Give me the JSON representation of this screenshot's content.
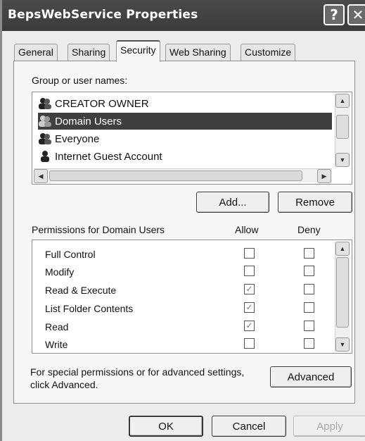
{
  "window": {
    "title": "BepsWebService Properties",
    "help_glyph": "?",
    "close_glyph": "✕"
  },
  "tabs": [
    {
      "label": "General",
      "active": false
    },
    {
      "label": "Sharing",
      "active": false
    },
    {
      "label": "Security",
      "active": true
    },
    {
      "label": "Web Sharing",
      "active": false
    },
    {
      "label": "Customize",
      "active": false
    }
  ],
  "group_section": {
    "label": "Group or user names:",
    "users": [
      {
        "name": "CREATOR OWNER",
        "icon": "group-icon",
        "selected": false
      },
      {
        "name": "Domain Users",
        "icon": "group-icon",
        "selected": true
      },
      {
        "name": "Everyone",
        "icon": "group-icon",
        "selected": false
      },
      {
        "name": "Internet Guest Account",
        "icon": "user-icon",
        "selected": false
      }
    ]
  },
  "buttons": {
    "add": "Add...",
    "remove": "Remove",
    "advanced": "Advanced",
    "ok": "OK",
    "cancel": "Cancel",
    "apply": "Apply"
  },
  "permissions": {
    "header": "Permissions for Domain Users",
    "allow_header": "Allow",
    "deny_header": "Deny",
    "rows": [
      {
        "name": "Full Control",
        "allow": false,
        "deny": false
      },
      {
        "name": "Modify",
        "allow": false,
        "deny": false
      },
      {
        "name": "Read & Execute",
        "allow": true,
        "deny": false
      },
      {
        "name": "List Folder Contents",
        "allow": true,
        "deny": false
      },
      {
        "name": "Read",
        "allow": true,
        "deny": false
      },
      {
        "name": "Write",
        "allow": false,
        "deny": false
      }
    ]
  },
  "advanced_text": {
    "line1": "For special permissions or for advanced settings,",
    "line2": "click Advanced."
  },
  "colors": {
    "selection": "#3f3f3f",
    "title_bar": "#3b3b3b"
  }
}
